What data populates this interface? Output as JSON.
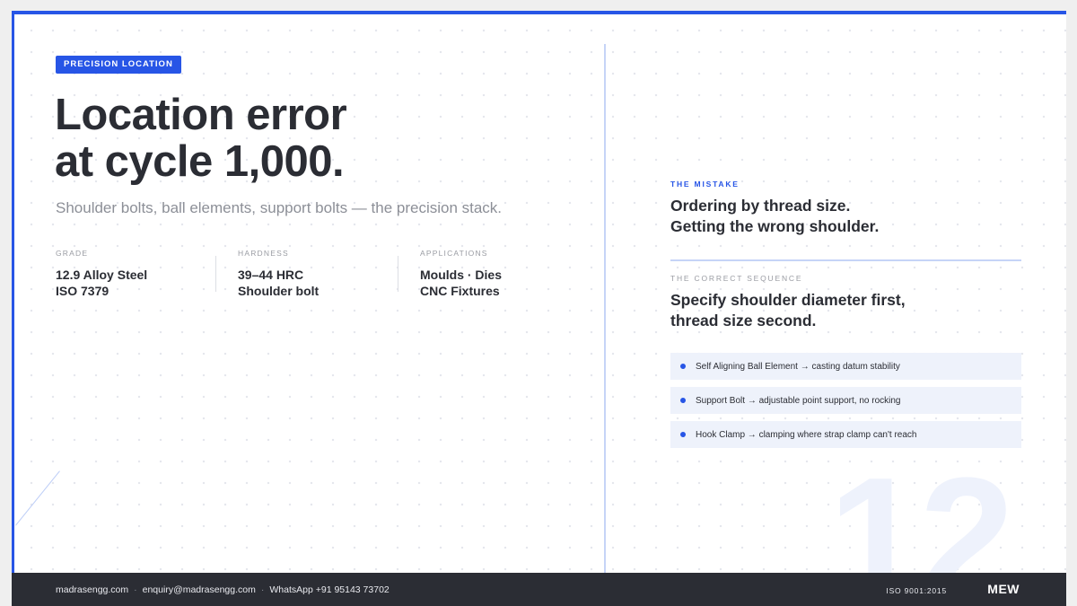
{
  "tag": "PRECISION LOCATION",
  "title_line1": "Location error",
  "title_line2": "at cycle 1,000.",
  "subtitle": "Shoulder bolts, ball elements, support bolts — the precision stack.",
  "specs": [
    {
      "label": "GRADE",
      "line1": "12.9 Alloy Steel",
      "line2": "ISO 7379"
    },
    {
      "label": "HARDNESS",
      "line1": "39–44 HRC",
      "line2": "Shoulder bolt"
    },
    {
      "label": "APPLICATIONS",
      "line1": "Moulds · Dies",
      "line2": "CNC Fixtures"
    }
  ],
  "mistake": {
    "label": "THE MISTAKE",
    "line1": "Ordering by thread size.",
    "line2": "Getting the wrong shoulder."
  },
  "sequence": {
    "label": "THE CORRECT SEQUENCE",
    "line1": "Specify shoulder diameter first,",
    "line2": "thread size second."
  },
  "items": [
    "Self Aligning Ball Element → casting datum stability",
    "Support Bolt → adjustable point support, no rocking",
    "Hook Clamp → clamping where strap clamp can't reach"
  ],
  "page_number": "12",
  "footer": {
    "website": "madrasengg.com",
    "email": "enquiry@madrasengg.com",
    "whatsapp": "WhatsApp +91 95143 73702",
    "iso": "ISO 9001:2015",
    "logo": "MEW"
  },
  "colors": {
    "accent": "#2755e6",
    "dark": "#2b2d34",
    "panel": "#eef2fb"
  }
}
